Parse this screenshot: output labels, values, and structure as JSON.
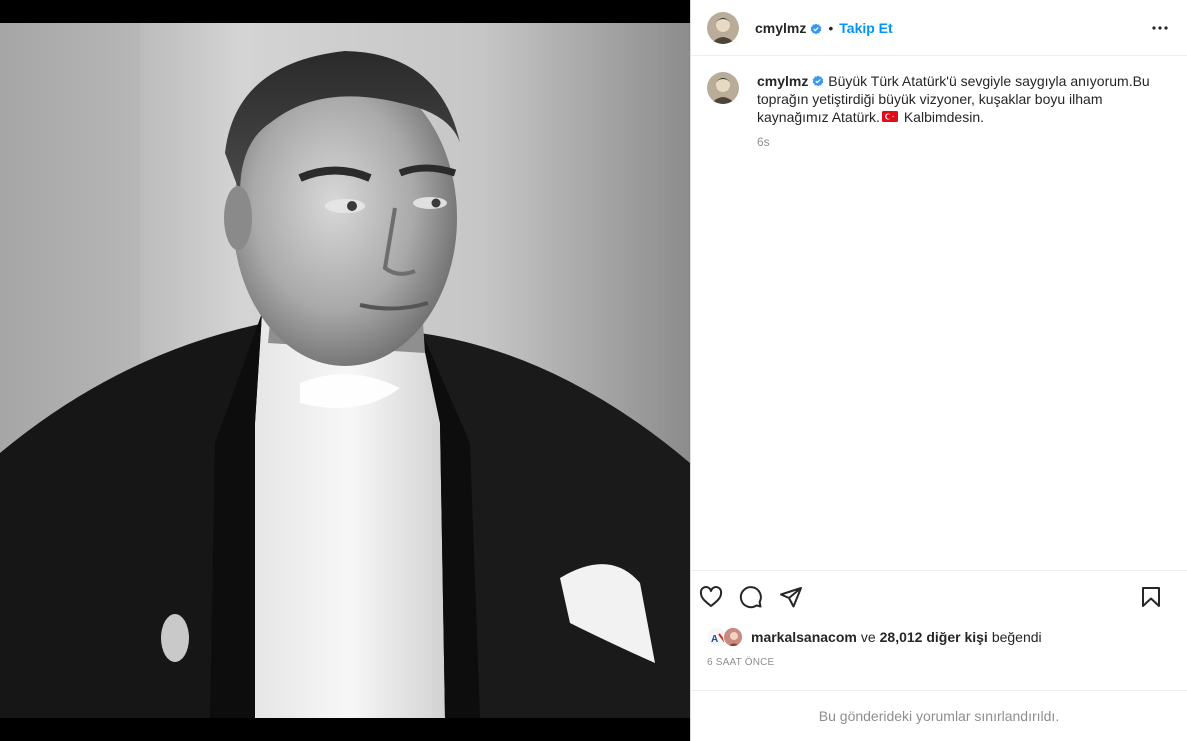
{
  "post": {
    "username": "cmylmz",
    "follow_label": "Takip Et",
    "separator": "•",
    "caption": {
      "part1": "Büyük Türk Atatürk'ü sevgiyle saygıyla anıyorum.Bu toprağın yetiştirdiği büyük vizyoner, kuşaklar boyu ilham kaynağımız Atatürk.",
      "part2": " Kalbimdesin.",
      "time": "6s"
    },
    "likes": {
      "liker": "markalsanacom",
      "joiner": "ve",
      "others": "28,012 diğer kişi",
      "suffix": "beğendi"
    },
    "timestamp": "6 SAAT ÖNCE",
    "comments_notice": "Bu gönderideki yorumlar sınırlandırıldı."
  },
  "icons": {
    "verified": "verified-badge-icon",
    "more": "more-options-icon",
    "like": "heart-icon",
    "comment": "comment-bubble-icon",
    "share": "paper-plane-icon",
    "save": "bookmark-icon",
    "flag": "turkey-flag-emoji"
  },
  "colors": {
    "accent": "#0095f6",
    "text": "#262626",
    "secondary": "#8e8e8e",
    "border": "#dbdbdb",
    "flag_red": "#e30a17"
  }
}
